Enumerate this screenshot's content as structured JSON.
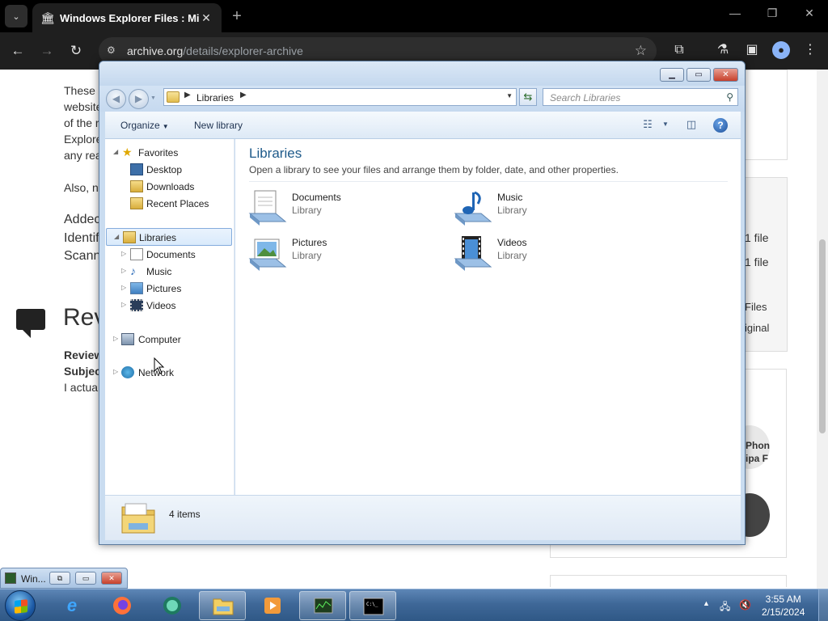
{
  "browser": {
    "tab_title": "Windows Explorer Files : Micro",
    "url_host": "archive.org",
    "url_path": "/details/explorer-archive"
  },
  "webpage": {
    "left_lines": [
      "These",
      "website",
      "of the r",
      "Explore",
      "any rea"
    ],
    "also_line": "Also, n",
    "added_lines": [
      "Addec",
      "Identif",
      "Scann"
    ],
    "review_heading": "Revi",
    "review_bold": [
      "Review",
      "Subjec"
    ],
    "review_text": "I actua",
    "right_labels": [
      "1 file",
      "1 file",
      "Files",
      "iginal"
    ],
    "right_avatar_text": [
      "Phon",
      "ipa F"
    ]
  },
  "explorer": {
    "address_crumb": "Libraries",
    "search_placeholder": "Search Libraries",
    "toolbar": {
      "organize": "Organize",
      "new_library": "New library"
    },
    "nav": {
      "favorites": "Favorites",
      "favorite_items": [
        "Desktop",
        "Downloads",
        "Recent Places"
      ],
      "libraries": "Libraries",
      "library_items": [
        "Documents",
        "Music",
        "Pictures",
        "Videos"
      ],
      "computer": "Computer",
      "network": "Network"
    },
    "content": {
      "heading": "Libraries",
      "description": "Open a library to see your files and arrange them by folder, date, and other properties.",
      "items": [
        {
          "name": "Documents",
          "type": "Library"
        },
        {
          "name": "Music",
          "type": "Library"
        },
        {
          "name": "Pictures",
          "type": "Library"
        },
        {
          "name": "Videos",
          "type": "Library"
        }
      ]
    },
    "status": {
      "count": "4 items"
    }
  },
  "minimized": {
    "label": "Win..."
  },
  "taskbar": {
    "time": "3:55 AM",
    "date": "2/15/2024"
  },
  "colors": {
    "taskbar": "#3f6898",
    "library_heading": "#1e5a8a",
    "chrome_bg": "#1f1f1f"
  }
}
